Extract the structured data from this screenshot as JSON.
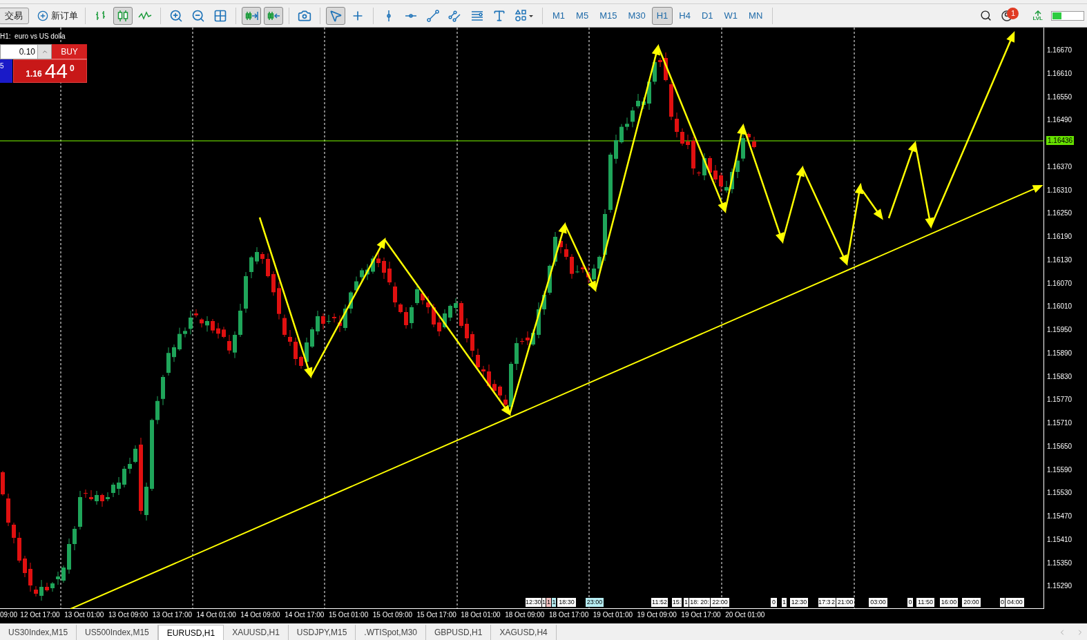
{
  "toolbar": {
    "trade_button": {
      "label": "交易"
    },
    "new_order_button": {
      "label": "新订单"
    },
    "tools": [
      {
        "kind": "bars",
        "selected": false
      },
      {
        "kind": "candles",
        "selected": true
      },
      {
        "kind": "line",
        "selected": false
      },
      {
        "kind": "zoomin",
        "selected": false
      },
      {
        "kind": "zoomout",
        "selected": false
      },
      {
        "kind": "tile",
        "selected": false
      },
      {
        "kind": "autoscroll",
        "selected": true
      },
      {
        "kind": "shift",
        "selected": true
      },
      {
        "kind": "screenshot",
        "selected": false
      },
      {
        "kind": "cursor",
        "selected": true
      },
      {
        "kind": "crosshair",
        "selected": false
      },
      {
        "kind": "vline",
        "selected": false
      },
      {
        "kind": "hline",
        "selected": false
      },
      {
        "kind": "trendline",
        "selected": false
      },
      {
        "kind": "channel",
        "selected": false
      },
      {
        "kind": "fibo",
        "selected": false
      },
      {
        "kind": "text",
        "selected": false
      },
      {
        "kind": "shapes",
        "selected": false
      }
    ],
    "timeframes": [
      {
        "label": "M1",
        "selected": false
      },
      {
        "label": "M5",
        "selected": false
      },
      {
        "label": "M15",
        "selected": false
      },
      {
        "label": "M30",
        "selected": false
      },
      {
        "label": "H1",
        "selected": true
      },
      {
        "label": "H4",
        "selected": false
      },
      {
        "label": "D1",
        "selected": false
      },
      {
        "label": "W1",
        "selected": false
      },
      {
        "label": "MN",
        "selected": false
      }
    ],
    "notifications_badge": "1",
    "level_label": "LVL",
    "signal": {
      "level": 0.3
    }
  },
  "chart": {
    "title": "H1:  euro vs US dolla",
    "one_click": {
      "lot": "0.10",
      "buy_label": "BUY",
      "sell_fragment": "5",
      "price_prefix": "1.16",
      "price_big": "44",
      "price_sup": "0"
    },
    "price_axis": [
      "1.16670",
      "1.16610",
      "1.16550",
      "1.16490",
      "1.16370",
      "1.16310",
      "1.16250",
      "1.16190",
      "1.16130",
      "1.16070",
      "1.16010",
      "1.15950",
      "1.15890",
      "1.15830",
      "1.15770",
      "1.15710",
      "1.15650",
      "1.15590",
      "1.15530",
      "1.15470",
      "1.15410",
      "1.15350",
      "1.15290"
    ],
    "current_price": "1.16436",
    "time_axis": [
      "09:00",
      "12 Oct 17:00",
      "13 Oct 01:00",
      "13 Oct 09:00",
      "13 Oct 17:00",
      "14 Oct 01:00",
      "14 Oct 09:00",
      "14 Oct 17:00",
      "15 Oct 01:00",
      "15 Oct 09:00",
      "15 Oct 17:00",
      "18 Oct 01:00",
      "18 Oct 09:00",
      "18 Oct 17:00",
      "19 Oct 01:00",
      "19 Oct 09:00",
      "19 Oct 17:00",
      "20 Oct 01:00"
    ],
    "event_markers": [
      {
        "label": "12:30",
        "color": "#ffffff"
      },
      {
        "label": "1",
        "color": "#ffffff"
      },
      {
        "label": "1",
        "color": "#f4c2c2"
      },
      {
        "label": "1",
        "color": "#b8eef4"
      },
      {
        "label": "18:30",
        "color": "#ffffff"
      },
      {
        "label": "23:00",
        "color": "#b8eef4"
      },
      {
        "label": "11:52",
        "color": "#ffffff"
      },
      {
        "label": "15:",
        "color": "#ffffff"
      },
      {
        "label": "1",
        "color": "#ffffff"
      },
      {
        "label": "18:",
        "color": "#ffffff"
      },
      {
        "label": "20:",
        "color": "#ffffff"
      },
      {
        "label": "22:00",
        "color": "#ffffff"
      },
      {
        "label": "0",
        "color": "#ffffff"
      },
      {
        "label": "1",
        "color": "#ffffff"
      },
      {
        "label": "12:30",
        "color": "#ffffff"
      },
      {
        "label": "17:3",
        "color": "#ffffff"
      },
      {
        "label": "2",
        "color": "#ffffff"
      },
      {
        "label": "21:00",
        "color": "#ffffff"
      },
      {
        "label": "03:00",
        "color": "#ffffff"
      },
      {
        "label": "0",
        "color": "#ffffff"
      },
      {
        "label": "11:50",
        "color": "#ffffff"
      },
      {
        "label": "16:00",
        "color": "#ffffff"
      },
      {
        "label": "20:00",
        "color": "#ffffff"
      },
      {
        "label": "0",
        "color": "#ffffff"
      },
      {
        "label": "04:00",
        "color": "#ffffff"
      }
    ]
  },
  "tabs": [
    {
      "label": "US30Index,M15",
      "selected": false
    },
    {
      "label": "US500Index,M15",
      "selected": false
    },
    {
      "label": "EURUSD,H1",
      "selected": true
    },
    {
      "label": "XAUUSD,H1",
      "selected": false
    },
    {
      "label": "USDJPY,M15",
      "selected": false
    },
    {
      "label": ".WTISpot,M30",
      "selected": false
    },
    {
      "label": "GBPUSD,H1",
      "selected": false
    },
    {
      "label": "XAGUSD,H4",
      "selected": false
    }
  ]
}
